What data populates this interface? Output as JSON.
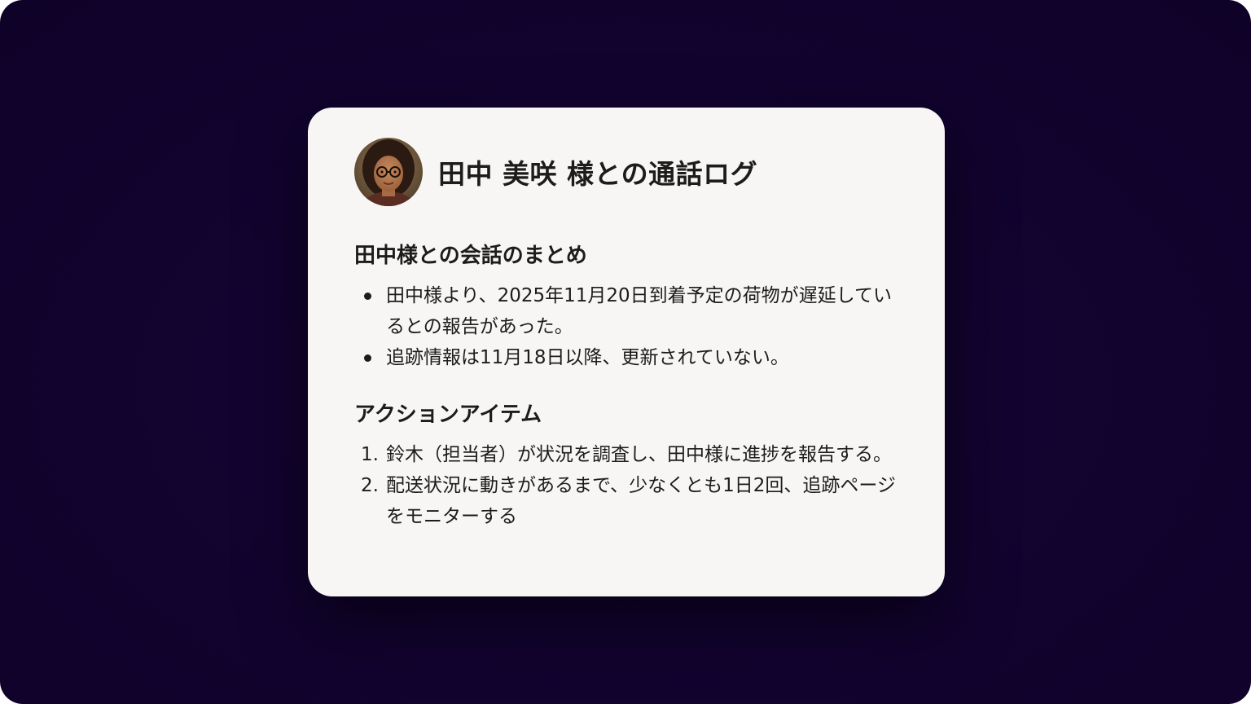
{
  "card": {
    "title": "田中 美咲 様との通話ログ",
    "avatar_icon": "person-avatar"
  },
  "summary": {
    "heading": "田中様との会話のまとめ",
    "items": [
      "田中様より、2025年11月20日到着予定の荷物が遅延しているとの報告があった。",
      "追跡情報は11月18日以降、更新されていない。"
    ]
  },
  "actions": {
    "heading": "アクションアイテム",
    "items": [
      {
        "number": "1.",
        "text": "鈴木（担当者）が状況を調査し、田中様に進捗を報告する。"
      },
      {
        "number": "2.",
        "text": "配送状況に動きがあるまで、少なくとも1日2回、追跡ページをモニターする"
      }
    ]
  },
  "colors": {
    "background": "#12032e",
    "card": "#f7f6f4",
    "text": "#1d1c1a"
  }
}
